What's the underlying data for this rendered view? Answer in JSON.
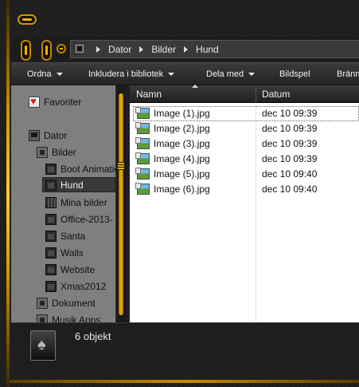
{
  "breadcrumb": [
    "Dator",
    "Bilder",
    "Hund"
  ],
  "toolbar": [
    {
      "label": "Ordna",
      "dropdown": true
    },
    {
      "label": "Inkludera i bibliotek",
      "dropdown": true
    },
    {
      "label": "Dela med",
      "dropdown": true
    },
    {
      "label": "Bildspel",
      "dropdown": false
    },
    {
      "label": "Bränn",
      "dropdown": false
    }
  ],
  "sidebar": [
    {
      "label": "Favoriter",
      "icon": "favorites-star-icon"
    },
    {
      "label": "Dator",
      "icon": "computer-icon"
    },
    {
      "label": "Bilder",
      "icon": "library-icon"
    },
    {
      "label": "Boot Animation",
      "icon": "folder-icon"
    },
    {
      "label": "Hund",
      "icon": "folder-icon",
      "selected": true
    },
    {
      "label": "Mina bilder",
      "icon": "folder-icon"
    },
    {
      "label": "Office-2013-",
      "icon": "folder-icon"
    },
    {
      "label": "Santa",
      "icon": "folder-icon"
    },
    {
      "label": "Walls",
      "icon": "folder-icon"
    },
    {
      "label": "Website",
      "icon": "folder-icon"
    },
    {
      "label": "Xmas2012",
      "icon": "folder-icon"
    },
    {
      "label": "Dokument",
      "icon": "library-icon"
    },
    {
      "label": "Musik Apps",
      "icon": "library-icon"
    }
  ],
  "columns": {
    "name": "Namn",
    "date": "Datum"
  },
  "files": [
    {
      "name": "Image (1).jpg",
      "date": "dec 10 09:39"
    },
    {
      "name": "Image (2).jpg",
      "date": "dec 10 09:39"
    },
    {
      "name": "Image (3).jpg",
      "date": "dec 10 09:39"
    },
    {
      "name": "Image (4).jpg",
      "date": "dec 10 09:39"
    },
    {
      "name": "Image (5).jpg",
      "date": "dec 10 09:40"
    },
    {
      "name": "Image (6).jpg",
      "date": "dec 10 09:40"
    }
  ],
  "status": {
    "count_text": "6 objekt"
  },
  "colors": {
    "accent": "#f0b400",
    "chrome": "#1e1e1e",
    "sidebar_bg": "#7f7f7f",
    "content_bg": "#ffffff"
  }
}
